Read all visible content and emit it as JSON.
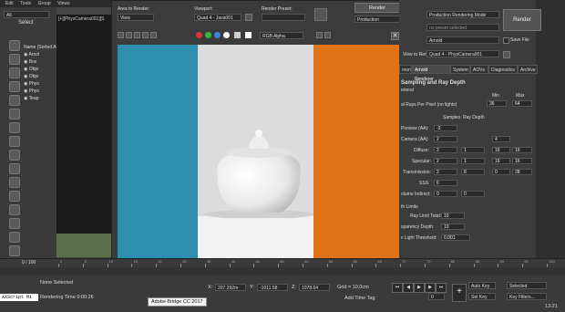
{
  "topbar": {
    "menus": [
      "Edit",
      "Tools",
      "Group",
      "Views"
    ]
  },
  "left": {
    "select_label": "Select",
    "filter_value": "All",
    "tree_header": "Name (Sorted A",
    "tree_items": [
      "Arnol",
      "Box",
      "Obje",
      "Obje",
      "Phys",
      "Phys",
      "Teap"
    ]
  },
  "viewport": {
    "label": "[+][PhysCamera001][S"
  },
  "render_window": {
    "area_label": "Area to Render:",
    "area_value": "View",
    "viewport_label": "Viewport:",
    "viewport_value": "Quad 4 - Java001",
    "preset_label": "Render Preset:",
    "render_button": "Render",
    "production_value": "Production",
    "channel_value": "RGB Alpha"
  },
  "settings": {
    "mode_value": "Production Rendering Mode",
    "render_button": "Render",
    "preset_placeholder": "no preset selected",
    "renderer_value": "Arnold",
    "save_file_label": "Save File",
    "view_label": "View to Render:",
    "view_value": "Quad 4 - PhysCamera001",
    "tabs": [
      "mon",
      "Arnold Renderer",
      "System",
      "AOVs",
      "Diagnostics",
      "Archive"
    ],
    "section_title": "Sampling and Ray Depth",
    "subsection": "eneral",
    "min_label": "Min",
    "max_label": "Max",
    "rays_label": "al Rays Per Pixel (no lights)",
    "rays_min": "36",
    "rays_max": "64",
    "preview_label": "Preview (AA):",
    "preview_value": "-3",
    "samples_header": "Samples",
    "raydepth_header": "Ray Depth",
    "rows": [
      {
        "label": "Camera (AA):",
        "samples": "2",
        "depth": "",
        "min": "4",
        "max": ""
      },
      {
        "label": "Diffuse:",
        "samples": "2",
        "depth": "1",
        "min": "16",
        "max": "16"
      },
      {
        "label": "Specular:",
        "samples": "2",
        "depth": "1",
        "min": "16",
        "max": "16"
      },
      {
        "label": "Transmission:",
        "samples": "2",
        "depth": "8",
        "min": "0",
        "max": "28"
      },
      {
        "label": "SSS:",
        "samples": "0",
        "depth": "",
        "min": "",
        "max": ""
      },
      {
        "label": "olume Indirect:",
        "samples": "0",
        "depth": "0",
        "min": "",
        "max": ""
      }
    ],
    "depth_title": "th Limits",
    "ray_limit_label": "Ray Limit Total:",
    "ray_limit_value": "10",
    "transparency_label": "sparency Depth:",
    "transparency_value": "10",
    "light_threshold_label": "v Light Threshold:",
    "light_threshold_value": "0.001"
  },
  "timeline": {
    "frame_label": "0 / 100",
    "ticks": [
      "0",
      "5",
      "10",
      "15",
      "20",
      "25",
      "30",
      "35",
      "40",
      "45",
      "50",
      "55",
      "60",
      "65",
      "70",
      "75",
      "80",
      "85",
      "90",
      "95",
      "100"
    ]
  },
  "status": {
    "maxscript": "AXScript Mi",
    "selection": "None Selected",
    "rendering_time": "Rendering Time  0:00:26",
    "x_label": "X:",
    "x_value": "207.292m",
    "y_label": "Y:",
    "y_value": "-1011.58",
    "z_label": "Z:",
    "z_value": "1078.64",
    "grid": "Grid = 10,0cm",
    "add_time_tag": "Add Time Tag",
    "auto_key": "Auto Key",
    "set_key": "Set Key",
    "selected_value": "Selected",
    "key_filters": "Key Filters...",
    "frame_value": "0",
    "clock": "13:21",
    "tooltip": "Adobe Bridge CC 2017"
  }
}
